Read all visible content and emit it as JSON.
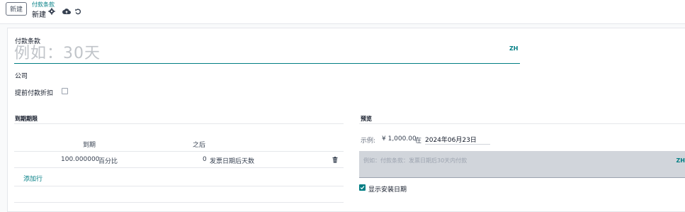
{
  "toolbar": {
    "new_label": "新建",
    "breadcrumb": "付款条款",
    "record_label": "新建"
  },
  "form": {
    "name_label": "付款条款",
    "name_placeholder": "例如：30天",
    "lang_code": "ZH",
    "company_label": "公司",
    "early_discount_label": "提前付款折扣"
  },
  "due_terms": {
    "section_title": "到期期限",
    "columns": [
      "到期",
      "之后"
    ],
    "rows": [
      {
        "value": "100.000000",
        "value_type": "百分比",
        "days": "0",
        "delay_type": "发票日期后天数"
      }
    ],
    "add_line": "添加行"
  },
  "preview": {
    "section_title": "预览",
    "example_label": "示例:",
    "amount": "¥ 1,000.00",
    "in_label": "在",
    "date": "2024年06月23日",
    "note_placeholder": "例如：付款条款：发票日期后30天内付款",
    "note_lang_code": "ZH",
    "show_installments_label": "显示安装日期",
    "show_installments_checked": true
  },
  "colors": {
    "accent": "#017e84",
    "note_bg": "#d1d5db"
  }
}
